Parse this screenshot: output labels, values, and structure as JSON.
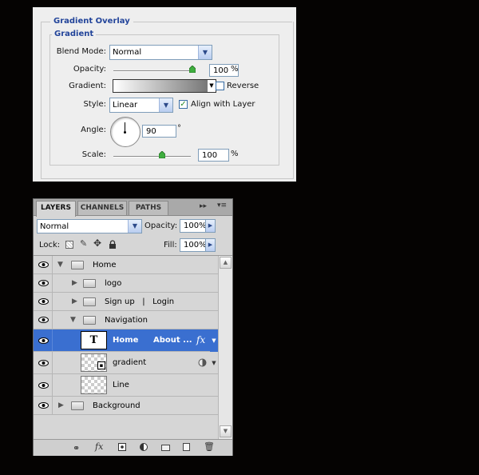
{
  "gradient_overlay": {
    "title": "Gradient Overlay",
    "section_title": "Gradient",
    "blend_mode": {
      "label": "Blend Mode:",
      "value": "Normal"
    },
    "opacity": {
      "label": "Opacity:",
      "value": "100",
      "unit": "%",
      "slider_percent": 100
    },
    "gradient": {
      "label": "Gradient:",
      "reverse_label": "Reverse",
      "reverse_checked": false
    },
    "style": {
      "label": "Style:",
      "value": "Linear",
      "align_label": "Align with Layer",
      "align_checked": true
    },
    "angle": {
      "label": "Angle:",
      "value": "90",
      "unit": "°"
    },
    "scale": {
      "label": "Scale:",
      "value": "100",
      "unit": "%",
      "slider_percent": 40
    }
  },
  "layers_panel": {
    "tabs": [
      "LAYERS",
      "CHANNELS",
      "PATHS"
    ],
    "active_tab": "LAYERS",
    "menu_glyph": "▸▸",
    "menu_lines": "▾≡",
    "blend_mode": "Normal",
    "opacity_label": "Opacity:",
    "opacity_value": "100%",
    "lock_label": "Lock:",
    "fill_label": "Fill:",
    "fill_value": "100%",
    "layers": [
      {
        "name": "Home",
        "type": "folder",
        "expanded": true,
        "level": 0
      },
      {
        "name": "logo",
        "type": "folder",
        "expanded": false,
        "level": 1
      },
      {
        "name": "Sign up   |   Login",
        "type": "folder",
        "expanded": false,
        "level": 1
      },
      {
        "name": "Navigation",
        "type": "folder",
        "expanded": true,
        "level": 1
      },
      {
        "name": "Home",
        "name2": "About ...",
        "type": "text",
        "selected": true,
        "level": 2,
        "fx": "fx",
        "thumb_glyph": "T"
      },
      {
        "name": "gradient",
        "type": "smart",
        "level": 2
      },
      {
        "name": "Line",
        "type": "layer",
        "level": 2
      },
      {
        "name": "Background",
        "type": "folder",
        "expanded": false,
        "level": 0
      }
    ],
    "bottom_icons": [
      "link-icon",
      "fx-icon",
      "mask-icon",
      "adjustment-icon",
      "new-group-icon",
      "new-layer-icon",
      "trash-icon"
    ],
    "bottom_glyphs": {
      "fx": "fx"
    },
    "colors": {
      "selected_row": "#3a6fd0",
      "dialog_heading": "#22449a"
    }
  }
}
